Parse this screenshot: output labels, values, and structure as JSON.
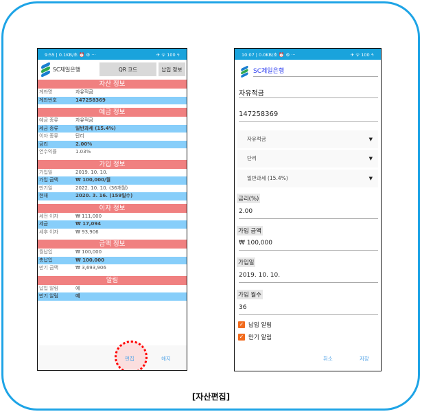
{
  "caption": "[자산편집]",
  "view_screen": {
    "status": {
      "time": "9:55 | 0.1KB/초 ⏰ ⚙ ···",
      "icons": "✈ ᯤ 100 ϟ"
    },
    "bank_name": "SC제일은행",
    "qr_button": "QR 코드",
    "payment_info_button": "납입 정보",
    "sections": [
      {
        "title": "자산 정보",
        "rows": [
          {
            "k": "계좌명",
            "v": "자유적금"
          },
          {
            "k": "계좌번호",
            "v": "147258369"
          }
        ]
      },
      {
        "title": "예금 정보",
        "rows": [
          {
            "k": "예금 종류",
            "v": "자유적금"
          },
          {
            "k": "세금 종류",
            "v": "일반과세 (15.4%)"
          },
          {
            "k": "이자 종류",
            "v": "단리"
          },
          {
            "k": "금리",
            "v": "2.00%"
          },
          {
            "k": "연수익률",
            "v": "1.03%"
          }
        ]
      },
      {
        "title": "가입 정보",
        "rows": [
          {
            "k": "가입일",
            "v": "2019. 10. 10."
          },
          {
            "k": "가입 금액",
            "v": "₩ 100,000/월"
          },
          {
            "k": "만기일",
            "v": "2022. 10. 10. (36개월)"
          },
          {
            "k": "현재",
            "v": "2020. 3. 16. (159일수)"
          }
        ]
      },
      {
        "title": "이자 정보",
        "rows": [
          {
            "k": "세전 이자",
            "v": "₩ 111,000"
          },
          {
            "k": "세금",
            "v": "₩ 17,094"
          },
          {
            "k": "세후 이자",
            "v": "₩ 93,906"
          }
        ]
      },
      {
        "title": "금액 정보",
        "rows": [
          {
            "k": "월납입",
            "v": "₩ 100,000"
          },
          {
            "k": "총납입",
            "v": "₩ 100,000"
          },
          {
            "k": "만기 금액",
            "v": "₩ 3,693,906"
          }
        ]
      },
      {
        "title": "알림",
        "rows": [
          {
            "k": "납입 알림",
            "v": "예"
          },
          {
            "k": "만기 알림",
            "v": "예"
          }
        ]
      }
    ],
    "edit_button": "편집",
    "terminate_button": "해지"
  },
  "edit_screen": {
    "status": {
      "time": "10:07 | 0.0KB/초 ⏰ ⚙ ···",
      "icons": "✈ ᯤ 100 ϟ"
    },
    "bank_name": "SC제일은행",
    "account_name": "자유적금",
    "account_number": "147258369",
    "deposit_type": "자유적금",
    "interest_type": "단리",
    "tax_type": "일반과세 (15.4%)",
    "rate_label": "금리(%)",
    "rate_value": "2.00",
    "amount_label": "가입 금액",
    "amount_value": "₩ 100,000",
    "date_label": "가입일",
    "date_value": "2019. 10. 10.",
    "months_label": "가입 월수",
    "months_value": "36",
    "payment_alarm": {
      "label": "납입 알림",
      "checked": true
    },
    "maturity_alarm": {
      "label": "만기 알림",
      "checked": true
    },
    "cancel_button": "취소",
    "save_button": "저장"
  },
  "colors": {
    "accent": "#1ea4e6",
    "section_header": "#f08080",
    "highlight_row": "#87cefa",
    "checkbox": "#f26b1d",
    "highlight_circle": "#ff0000"
  }
}
